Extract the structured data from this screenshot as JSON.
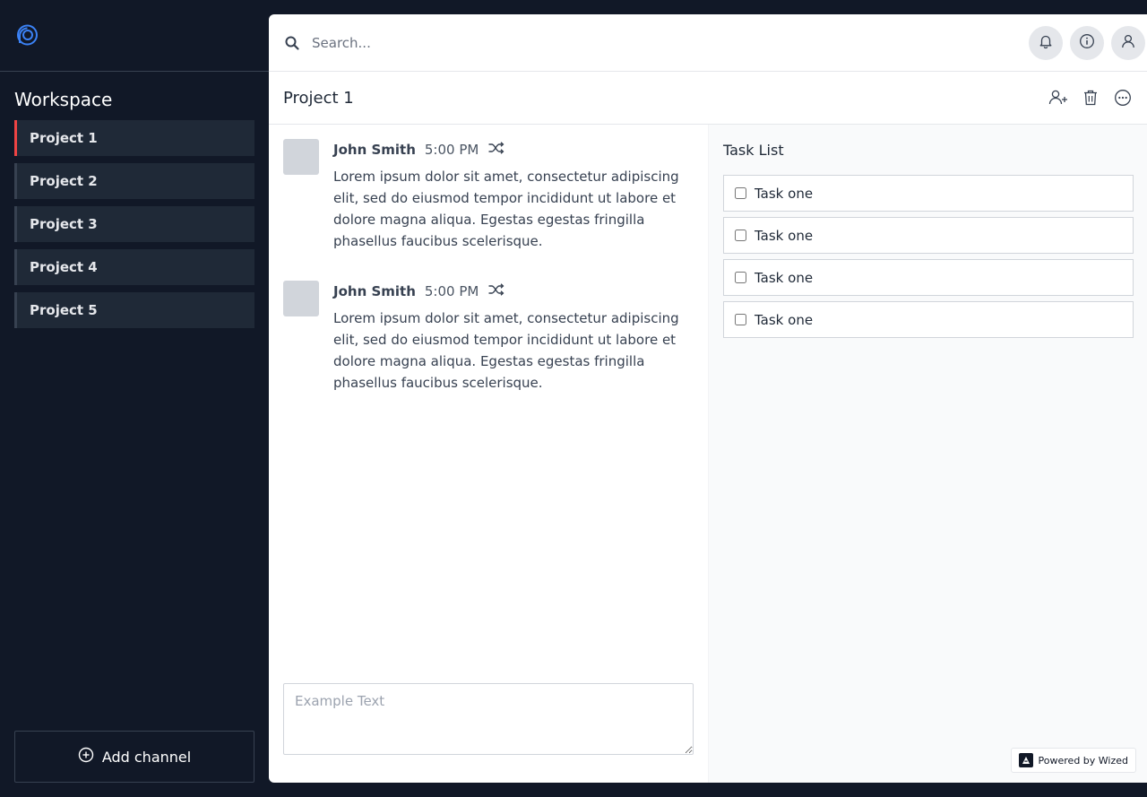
{
  "sidebar": {
    "logo_icon": "chat-bubble-logo-icon",
    "workspace_title": "Workspace",
    "projects": [
      {
        "label": "Project 1",
        "active": true
      },
      {
        "label": "Project 2",
        "active": false
      },
      {
        "label": "Project 3",
        "active": false
      },
      {
        "label": "Project 4",
        "active": false
      },
      {
        "label": "Project 5",
        "active": false
      }
    ],
    "add_channel_label": "Add channel",
    "add_channel_icon": "plus-circle-icon"
  },
  "topbar": {
    "search_placeholder": "Search...",
    "search_icon": "search-icon",
    "actions": [
      "bell-icon",
      "info-icon",
      "user-icon"
    ]
  },
  "channel": {
    "title": "Project 1",
    "actions": [
      "add-user-icon",
      "trash-icon",
      "more-icon"
    ]
  },
  "messages": [
    {
      "author": "John Smith",
      "time": "5:00 PM",
      "icon": "shuffle-icon",
      "text": "Lorem ipsum dolor sit amet, consectetur adipiscing elit, sed do eiusmod tempor incididunt ut labore et dolore magna aliqua. Egestas egestas fringilla phasellus faucibus scelerisque."
    },
    {
      "author": "John Smith",
      "time": "5:00 PM",
      "icon": "shuffle-icon",
      "text": "Lorem ipsum dolor sit amet, consectetur adipiscing elit, sed do eiusmod tempor incididunt ut labore et dolore magna aliqua. Egestas egestas fringilla phasellus faucibus scelerisque."
    }
  ],
  "composer": {
    "placeholder": "Example Text"
  },
  "tasks": {
    "title": "Task List",
    "items": [
      {
        "label": "Task one",
        "checked": false
      },
      {
        "label": "Task one",
        "checked": false
      },
      {
        "label": "Task one",
        "checked": false
      },
      {
        "label": "Task one",
        "checked": false
      }
    ]
  },
  "badge": {
    "label": "Powered by Wized"
  },
  "colors": {
    "sidebar_bg": "#111827",
    "active_accent": "#ef4444",
    "logo_blue": "#3b82f6"
  }
}
